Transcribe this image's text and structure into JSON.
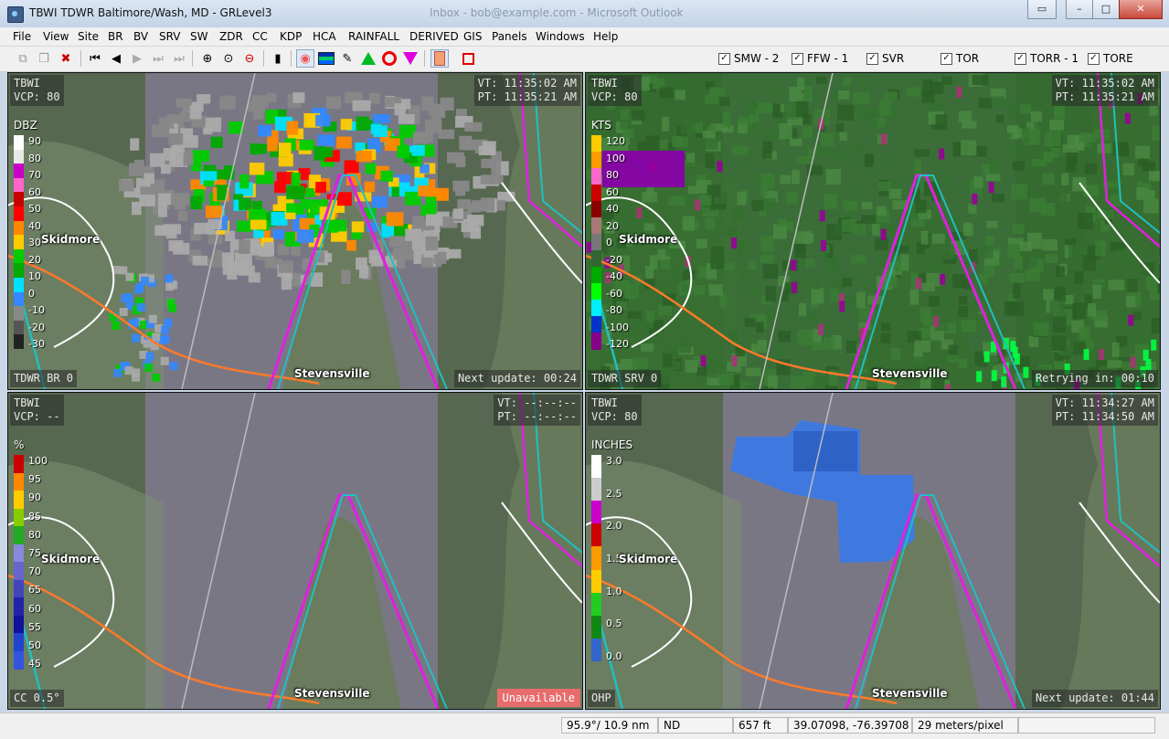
{
  "window": {
    "title": "TBWI TDWR Baltimore/Wash, MD - GRLevel3",
    "background_title": "Inbox - bob@example.com - Microsoft Outlook"
  },
  "menu": [
    "File",
    "View",
    "Site",
    "BR",
    "BV",
    "SRV",
    "SW",
    "ZDR",
    "CC",
    "KDP",
    "HCA",
    "RAINFALL",
    "DERIVED",
    "GIS",
    "Panels",
    "Windows",
    "Help"
  ],
  "toolbar": {
    "icons": [
      "copy-icon",
      "paste-icon",
      "site-select-icon",
      "first-frame-icon",
      "previous-frame-icon",
      "play-icon",
      "next-frame-icon",
      "last-frame-icon",
      "zoom-in-icon",
      "zoom-reset-icon",
      "zoom-out-icon",
      "stop-icon",
      "color-table-icon",
      "storm-tracks-icon",
      "pin-icon",
      "triangle-marker-icon",
      "circle-marker-icon",
      "inverted-triangle-icon",
      "placefile-icon",
      "record-icon"
    ],
    "warnings": [
      {
        "label": "SMW - 2",
        "checked": true
      },
      {
        "label": "FFW - 1",
        "checked": true
      },
      {
        "label": "SVR",
        "checked": true
      },
      {
        "label": "TOR",
        "checked": true
      },
      {
        "label": "TORR - 1",
        "checked": true
      },
      {
        "label": "TORE",
        "checked": true
      }
    ]
  },
  "panels": [
    {
      "site": "TBWI",
      "vcp": "VCP: 80",
      "vt": "VT: 11:35:02 AM",
      "pt": "PT: 11:35:21 AM",
      "units": "DBZ",
      "product": "TDWR BR 0",
      "footer": "Next update: 00:24",
      "legend": [
        "90",
        "80",
        "70",
        "60",
        "50",
        "40",
        "30",
        "20",
        "10",
        "0",
        "-10",
        "-20",
        "-30"
      ],
      "colors": [
        "#ffffff",
        "#e8e8e8",
        "#c800c8",
        "#ff66cc",
        "#c80000",
        "#ff0000",
        "#ff8800",
        "#ffcc00",
        "#00cc00",
        "#00aa00",
        "#00e0ff",
        "#3388ff",
        "#888888",
        "#555555",
        "#222222"
      ]
    },
    {
      "site": "TBWI",
      "vcp": "VCP: 80",
      "vt": "VT: 11:35:02 AM",
      "pt": "PT: 11:35:21 AM",
      "units": "KTS",
      "product": "TDWR SRV 0",
      "footer": "Retrying in: 00:10",
      "legend": [
        "120",
        "100",
        "80",
        "60",
        "40",
        "20",
        "0",
        "-20",
        "-40",
        "-60",
        "-80",
        "-100",
        "-120"
      ],
      "colors": [
        "#ffcc00",
        "#ff9900",
        "#ff66cc",
        "#cc0000",
        "#880000",
        "#aa7777",
        "#777777",
        "#336633",
        "#00aa00",
        "#00ff00",
        "#00eeff",
        "#0033cc",
        "#880088"
      ]
    },
    {
      "site": "TBWI",
      "vcp": "VCP: --",
      "vt": "VT: --:--:--",
      "pt": "PT: --:--:--",
      "units": "%",
      "product": "CC 0.5°",
      "footer": "Unavailable",
      "legend": [
        "100",
        "95",
        "90",
        "85",
        "80",
        "75",
        "70",
        "65",
        "60",
        "55",
        "50",
        "45"
      ],
      "colors": [
        "#cc0000",
        "#ff8800",
        "#ffcc00",
        "#88cc00",
        "#22aa22",
        "#8888dd",
        "#6666cc",
        "#4444bb",
        "#2222aa",
        "#111199",
        "#2244cc",
        "#3355dd"
      ]
    },
    {
      "site": "TBWI",
      "vcp": "VCP: 80",
      "vt": "VT: 11:34:27 AM",
      "pt": "PT: 11:34:50 AM",
      "units": "INCHES",
      "product": "OHP",
      "footer": "Next update: 01:44",
      "legend": [
        "3.0",
        "2.5",
        "2.0",
        "1.5",
        "1.0",
        "0.5",
        "0.0"
      ],
      "colors": [
        "#ffffff",
        "#cccccc",
        "#cc00cc",
        "#cc0000",
        "#ff9900",
        "#ffcc00",
        "#22cc22",
        "#118811",
        "#3366cc"
      ]
    }
  ],
  "places": {
    "skidmore": "Skidmore",
    "stevensville": "Stevensville"
  },
  "status": {
    "bearing": "95.9°/ 10.9 nm",
    "value": "ND",
    "height": "657 ft",
    "coords": "39.07098, -76.39708",
    "scale": "29 meters/pixel"
  }
}
